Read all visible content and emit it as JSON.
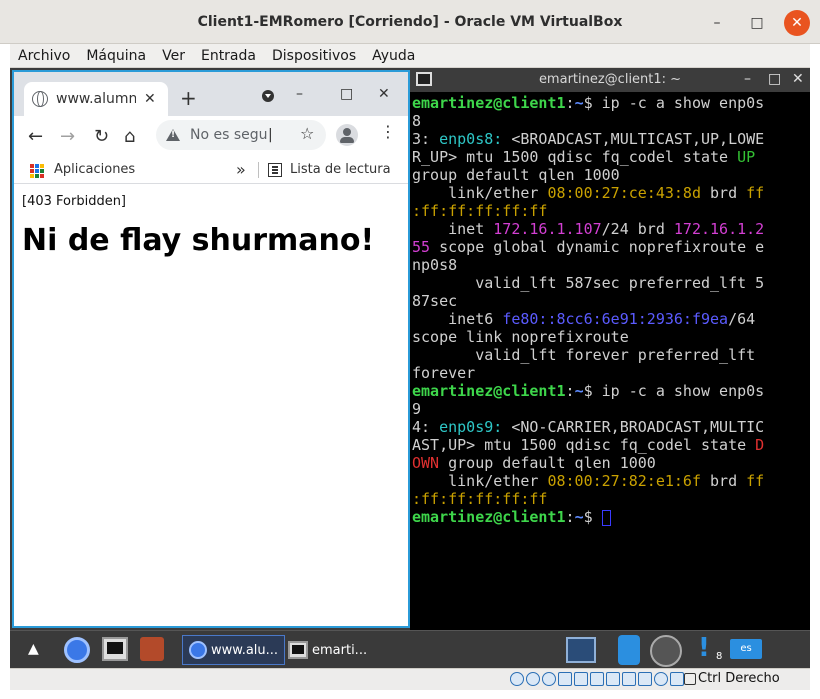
{
  "vbox": {
    "title": "Client1-EMRomero [Corriendo] - Oracle VM VirtualBox",
    "controls": [
      "–",
      "□",
      "✕"
    ],
    "menu": [
      "Archivo",
      "Máquina",
      "Ver",
      "Entrada",
      "Dispositivos",
      "Ayuda"
    ],
    "host_key": "Ctrl Derecho"
  },
  "chrome": {
    "tab_title": "www.alumn",
    "tab_close": "✕",
    "new_tab": "+",
    "win_controls": [
      "–",
      "□",
      "✕"
    ],
    "nav": {
      "back": "←",
      "forward": "→",
      "reload": "↻",
      "home": "⌂"
    },
    "omnibox": {
      "text": "No es segu",
      "caret": "|"
    },
    "star": "☆",
    "menu": "⋮",
    "bookmarks": {
      "apps_label": "Aplicaciones",
      "more": "»",
      "reading_list": "Lista de lectura"
    },
    "page": {
      "status": "[403 Forbidden]",
      "heading": "Ni de flay shurmano!"
    }
  },
  "terminal": {
    "title": "emartinez@client1: ~",
    "controls": [
      "–",
      "□",
      "✕"
    ],
    "lines": [
      [
        {
          "t": "emartinez@client1",
          "c": "green"
        },
        {
          "t": ":",
          "c": ""
        },
        {
          "t": "~",
          "c": "blue"
        },
        {
          "t": "$ ip -c a show enp0s",
          "c": ""
        }
      ],
      [
        {
          "t": "8",
          "c": ""
        }
      ],
      [
        {
          "t": "3: ",
          "c": ""
        },
        {
          "t": "enp0s8:",
          "c": "cyan"
        },
        {
          "t": " <BROADCAST,MULTICAST,UP,LOWE",
          "c": ""
        }
      ],
      [
        {
          "t": "R_UP> mtu 1500 qdisc fq_codel state ",
          "c": ""
        },
        {
          "t": "UP",
          "c": "dgreen"
        }
      ],
      [
        {
          "t": "group default qlen 1000",
          "c": ""
        }
      ],
      [
        {
          "t": "    link/ether ",
          "c": ""
        },
        {
          "t": "08:00:27:ce:43:8d",
          "c": "yellow"
        },
        {
          "t": " brd ",
          "c": ""
        },
        {
          "t": "ff",
          "c": "yellow"
        }
      ],
      [
        {
          "t": ":ff:ff:ff:ff:ff",
          "c": "yellow"
        }
      ],
      [
        {
          "t": "    inet ",
          "c": ""
        },
        {
          "t": "172.16.1.107",
          "c": "magenta"
        },
        {
          "t": "/24 brd ",
          "c": ""
        },
        {
          "t": "172.16.1.2",
          "c": "magenta"
        }
      ],
      [
        {
          "t": "55",
          "c": "magenta"
        },
        {
          "t": " scope global dynamic noprefixroute e",
          "c": ""
        }
      ],
      [
        {
          "t": "np0s8",
          "c": ""
        }
      ],
      [
        {
          "t": "       valid_lft 587sec preferred_lft 5",
          "c": ""
        }
      ],
      [
        {
          "t": "87sec",
          "c": ""
        }
      ],
      [
        {
          "t": "    inet6 ",
          "c": ""
        },
        {
          "t": "fe80::8cc6:6e91:2936:f9ea",
          "c": "lblue"
        },
        {
          "t": "/64",
          "c": ""
        }
      ],
      [
        {
          "t": "scope link noprefixroute",
          "c": ""
        }
      ],
      [
        {
          "t": "       valid_lft forever preferred_lft",
          "c": ""
        }
      ],
      [
        {
          "t": "forever",
          "c": ""
        }
      ],
      [
        {
          "t": "emartinez@client1",
          "c": "green"
        },
        {
          "t": ":",
          "c": ""
        },
        {
          "t": "~",
          "c": "blue"
        },
        {
          "t": "$ ip -c a show enp0s",
          "c": ""
        }
      ],
      [
        {
          "t": "9",
          "c": ""
        }
      ],
      [
        {
          "t": "4: ",
          "c": ""
        },
        {
          "t": "enp0s9:",
          "c": "cyan"
        },
        {
          "t": " <NO-CARRIER,BROADCAST,MULTIC",
          "c": ""
        }
      ],
      [
        {
          "t": "AST,UP> mtu 1500 qdisc fq_codel state ",
          "c": ""
        },
        {
          "t": "D",
          "c": "red"
        }
      ],
      [
        {
          "t": "OWN",
          "c": "red"
        },
        {
          "t": " group default qlen 1000",
          "c": ""
        }
      ],
      [
        {
          "t": "    link/ether ",
          "c": ""
        },
        {
          "t": "08:00:27:82:e1:6f",
          "c": "yellow"
        },
        {
          "t": " brd ",
          "c": ""
        },
        {
          "t": "ff",
          "c": "yellow"
        }
      ],
      [
        {
          "t": ":ff:ff:ff:ff:ff",
          "c": "yellow"
        }
      ],
      [
        {
          "t": "emartinez@client1",
          "c": "green"
        },
        {
          "t": ":",
          "c": ""
        },
        {
          "t": "~",
          "c": "blue"
        },
        {
          "t": "$ ",
          "c": ""
        }
      ]
    ]
  },
  "taskbar": {
    "up_arrow": "▲",
    "tasks": [
      {
        "label": "www.alu...",
        "active": true
      },
      {
        "label": "emarti...",
        "active": false
      }
    ],
    "notify_symbol": "!",
    "notify_count": "8",
    "lang": "es"
  },
  "colors": {
    "accent": "#2b9bd8",
    "close": "#e95420",
    "terminal_bg": "#000000"
  }
}
